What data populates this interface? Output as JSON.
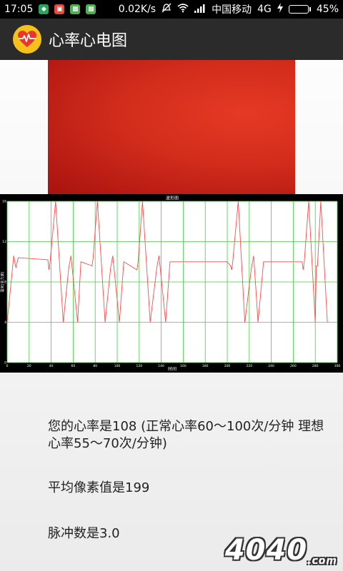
{
  "status_bar": {
    "time": "17:05",
    "speed": "0.02K/s",
    "carrier": "中国移动",
    "network": "4G",
    "battery": "45%",
    "battery_level": 0.45,
    "icons": [
      "notif-shield-icon",
      "notif-app-icon",
      "notif-android-icon",
      "notif-android-icon",
      "alarm-off-icon",
      "wifi-icon",
      "signal-icon",
      "charging-icon",
      "battery-icon"
    ]
  },
  "app_bar": {
    "title": "心率心电图",
    "icon": "heart-pulse-icon"
  },
  "chart": {
    "title": "波形图",
    "xlabel": "时间",
    "ylabel": "毫米(实力滚)"
  },
  "chart_data": {
    "type": "line",
    "title": "波形图",
    "xlabel": "时间",
    "ylabel": "毫米(实力滚)",
    "xlim": [
      0,
      300
    ],
    "ylim": [
      0,
      16
    ],
    "xticks": [
      0,
      20,
      40,
      60,
      80,
      100,
      120,
      140,
      160,
      180,
      200,
      220,
      240,
      260,
      280,
      300
    ],
    "yticks": [
      0,
      4,
      8,
      12,
      16
    ],
    "grid": true,
    "series": [
      {
        "color": "#ff4a4a",
        "points": [
          [
            0,
            4
          ],
          [
            6,
            10.6
          ],
          [
            8,
            9.4
          ],
          [
            10,
            10.4
          ],
          [
            37,
            10.2
          ],
          [
            38,
            9.2
          ],
          [
            39,
            10
          ],
          [
            44,
            16
          ],
          [
            51,
            4
          ],
          [
            56,
            9.4
          ],
          [
            58,
            10.6
          ],
          [
            64,
            4
          ],
          [
            67,
            10
          ],
          [
            77,
            9.6
          ],
          [
            78,
            10.2
          ],
          [
            82,
            16
          ],
          [
            89,
            4
          ],
          [
            94,
            9.4
          ],
          [
            96,
            10.6
          ],
          [
            102,
            4
          ],
          [
            106,
            10
          ],
          [
            118,
            9.2
          ],
          [
            119,
            10
          ],
          [
            123,
            16
          ],
          [
            130,
            4
          ],
          [
            136,
            9.4
          ],
          [
            138,
            10.6
          ],
          [
            144,
            4
          ],
          [
            148,
            10
          ],
          [
            168,
            10
          ],
          [
            200,
            10
          ],
          [
            203,
            9.6
          ],
          [
            204,
            9.2
          ],
          [
            205,
            10
          ],
          [
            210,
            16
          ],
          [
            216,
            4
          ],
          [
            222,
            9.4
          ],
          [
            224,
            10.6
          ],
          [
            228,
            4
          ],
          [
            233,
            10
          ],
          [
            268,
            10
          ],
          [
            269,
            9.2
          ],
          [
            270,
            10
          ],
          [
            274,
            16
          ],
          [
            280,
            4
          ],
          [
            281,
            9.6
          ],
          [
            282,
            9.6
          ],
          [
            285,
            16
          ],
          [
            291,
            4
          ]
        ]
      }
    ]
  },
  "info": {
    "heart_rate_text": "您的心率是108 (正常心率60～100次/分钟 理想心率55～70次/分钟)",
    "avg_pixel_text": "平均像素值是199",
    "pulse_text": "脉冲数是3.0"
  },
  "watermark": {
    "text": "4040",
    "sub": ".com"
  }
}
